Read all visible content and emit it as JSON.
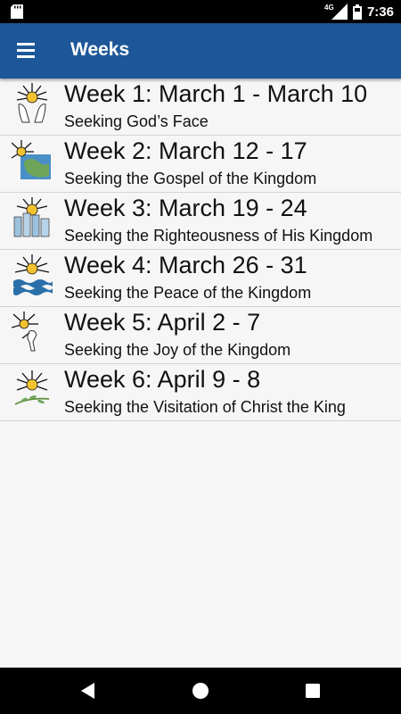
{
  "status_bar": {
    "network_label": "4G",
    "time": "7:36"
  },
  "app_bar": {
    "title": "Weeks",
    "menu_icon": "hamburger-menu-icon"
  },
  "weeks": [
    {
      "title": "Week 1: March 1 - March 10",
      "subtitle": "Seeking God’s Face",
      "icon": "praying-hands-sunburst-icon"
    },
    {
      "title": "Week 2: March 12 - 17",
      "subtitle": "Seeking the Gospel of the Kingdom",
      "icon": "globe-sunburst-icon"
    },
    {
      "title": "Week 3: March 19 - 24",
      "subtitle": "Seeking the Righteousness of His Kingdom",
      "icon": "city-sunburst-icon"
    },
    {
      "title": "Week 4: March 26 - 31",
      "subtitle": "Seeking the Peace of the Kingdom",
      "icon": "water-sunburst-icon"
    },
    {
      "title": "Week 5: April 2 - 7",
      "subtitle": "Seeking the Joy of the Kingdom",
      "icon": "dancer-sunburst-icon"
    },
    {
      "title": "Week 6: April 9 - 8",
      "subtitle": "Seeking the Visitation of Christ the King",
      "icon": "olive-branch-sunburst-icon"
    }
  ],
  "nav_bar": {
    "back_icon": "back-triangle-icon",
    "home_icon": "home-circle-icon",
    "recents_icon": "recents-square-icon"
  },
  "colors": {
    "app_bar": "#1d5799",
    "background": "#f6f6f6",
    "divider": "#d4d4d4",
    "status_bar": "#000000"
  }
}
